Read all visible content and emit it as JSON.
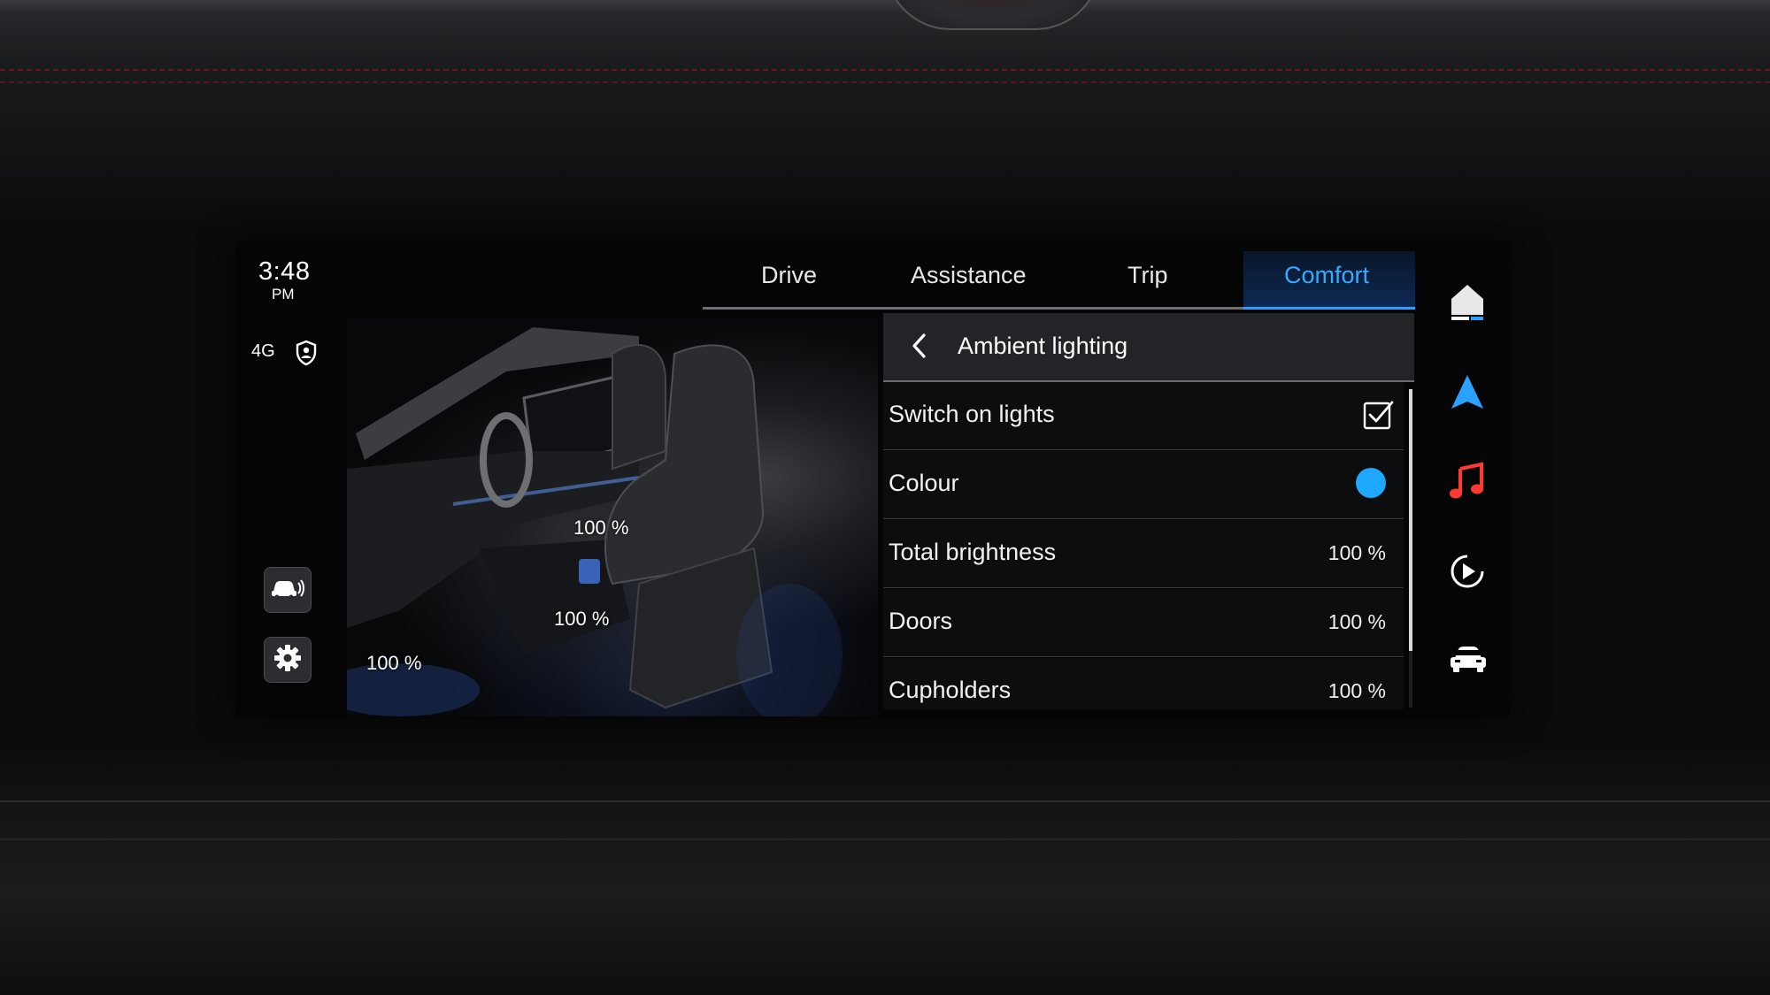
{
  "status": {
    "time": "3:48",
    "ampm": "PM",
    "network": "4G"
  },
  "tabs": [
    {
      "label": "Drive",
      "active": false
    },
    {
      "label": "Assistance",
      "active": false
    },
    {
      "label": "Trip",
      "active": false
    },
    {
      "label": "Comfort",
      "active": true
    }
  ],
  "panel": {
    "title": "Ambient lighting",
    "rows": [
      {
        "label": "Switch on lights",
        "control": "checkbox",
        "checked": true
      },
      {
        "label": "Colour",
        "control": "color-swatch",
        "color": "#1ea8ff"
      },
      {
        "label": "Total brightness",
        "value": "100 %"
      },
      {
        "label": "Doors",
        "value": "100 %"
      },
      {
        "label": "Cupholders",
        "value": "100 %"
      }
    ]
  },
  "interior": {
    "labels": [
      "100 %",
      "100 %",
      "100 %"
    ]
  },
  "left_buttons": [
    "car-sensor-icon",
    "gear-icon"
  ],
  "right_nav": [
    {
      "icon": "home-icon"
    },
    {
      "icon": "navigation-icon",
      "color": "#2aa0ff"
    },
    {
      "icon": "music-icon",
      "color": "#ff3a30"
    },
    {
      "icon": "media-play-icon"
    },
    {
      "icon": "car-icon"
    }
  ],
  "colors": {
    "accent": "#2aa0ff",
    "active_tab_bg": "#0c2a55"
  }
}
